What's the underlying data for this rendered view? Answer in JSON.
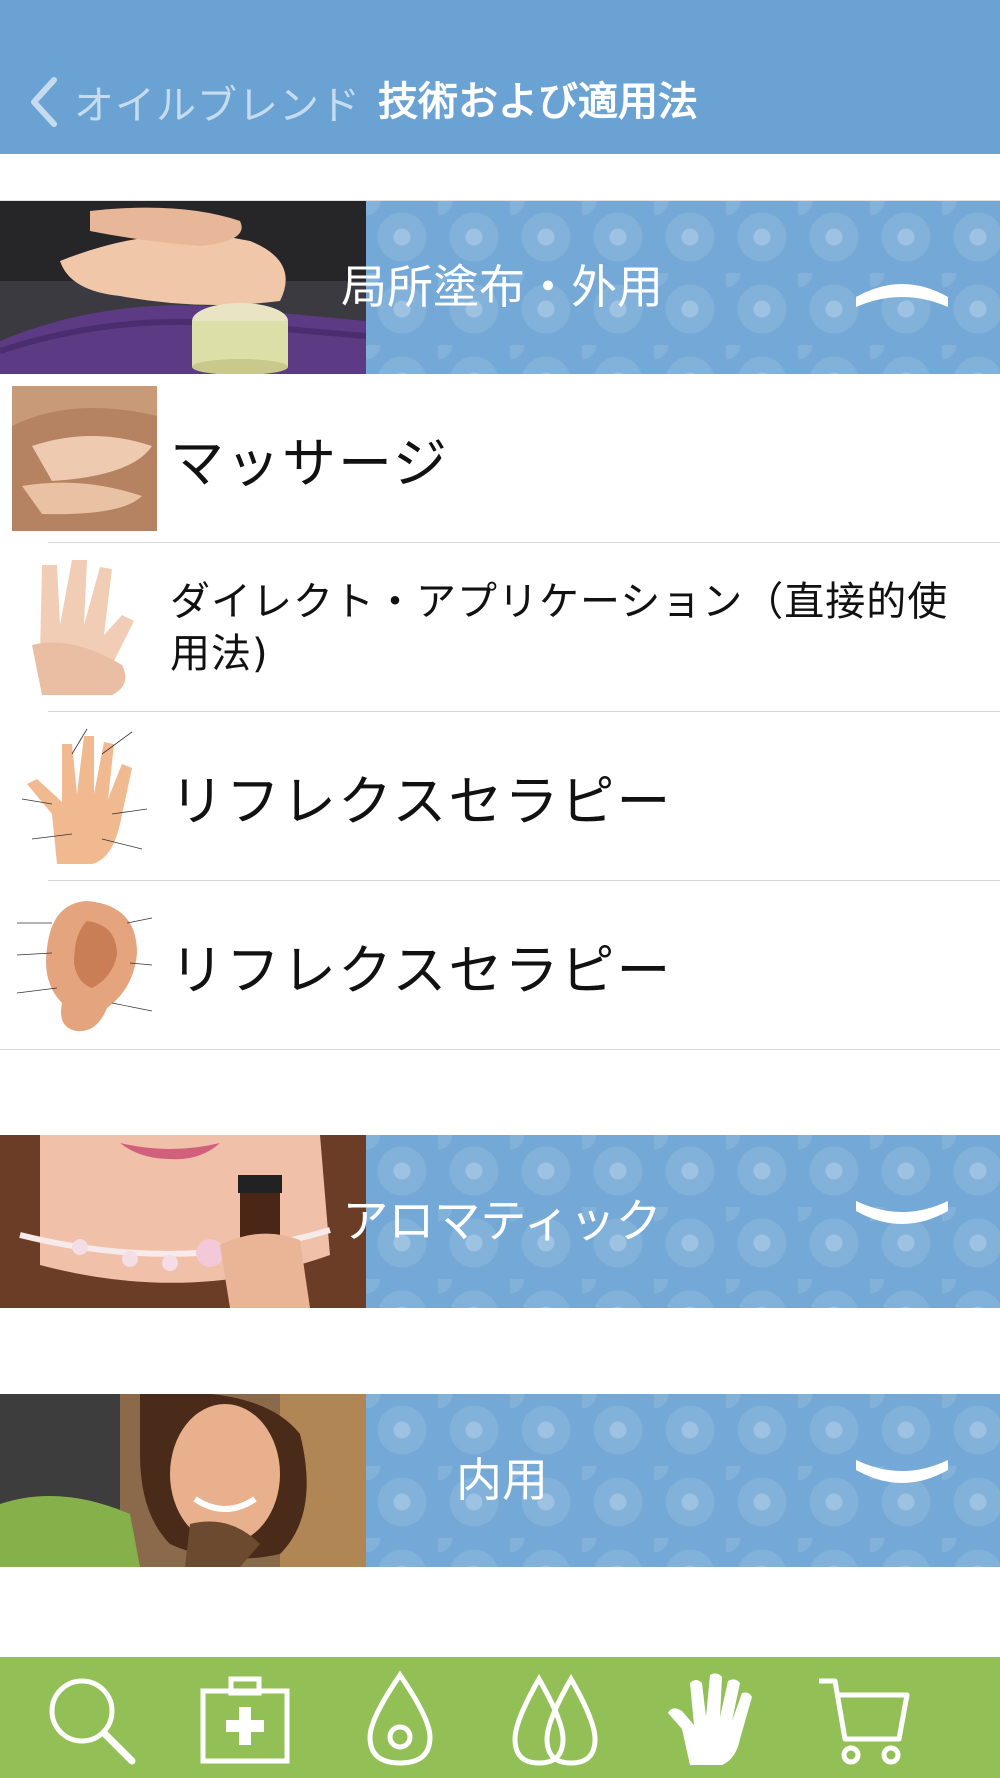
{
  "header": {
    "back_label": "オイルブレンド",
    "title": "技術および適用法"
  },
  "sections": [
    {
      "label": "局所塗布・外用",
      "expanded": true,
      "items": [
        {
          "label": "マッサージ",
          "thumb": "massage-photo"
        },
        {
          "label": "ダイレクト・アプリケーション（直接的使用法)",
          "thumb": "hands-photo"
        },
        {
          "label": "リフレクスセラピー",
          "thumb": "hand-reflexology-chart"
        },
        {
          "label": "リフレクスセラピー",
          "thumb": "ear-reflexology-chart"
        }
      ]
    },
    {
      "label": "アロマティック",
      "expanded": false
    },
    {
      "label": "内用",
      "expanded": false
    }
  ],
  "tabbar": {
    "icons": [
      "search-icon",
      "first-aid-kit-icon",
      "single-drop-icon",
      "oil-drops-icon",
      "hand-icon",
      "cart-icon",
      "more-icon"
    ]
  },
  "colors": {
    "header": "#6aa3d3",
    "section_band": "#74a8d6",
    "tabbar": "#92c057"
  }
}
